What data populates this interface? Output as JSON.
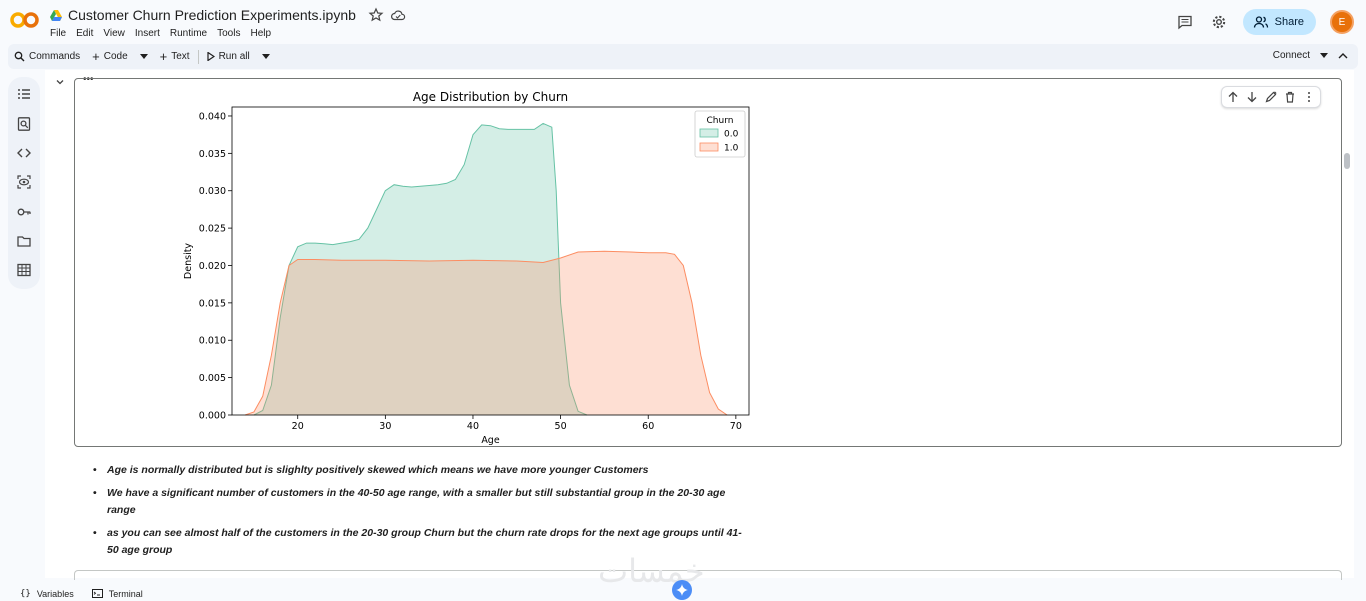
{
  "app": {
    "notebook_title": "Customer Churn Prediction Experiments.ipynb",
    "menu": [
      "File",
      "Edit",
      "View",
      "Insert",
      "Runtime",
      "Tools",
      "Help"
    ],
    "share_label": "Share",
    "avatar_letter": "E"
  },
  "toolbar": {
    "commands_label": "Commands",
    "code_label": "Code",
    "text_label": "Text",
    "run_all_label": "Run all",
    "connect_label": "Connect"
  },
  "statusbar": {
    "variables_label": "Variables",
    "terminal_label": "Terminal"
  },
  "output": {
    "markdown_items": [
      "Age is normally distributed but is slighlty positively skewed which means we have more younger Customers",
      "We have a significant number of customers in the 40-50 age range, with a smaller but still substantial group in the 20-30 age range",
      "as you can see almost half of the customers in the 20-30 group Churn but the churn rate drops for the next age groups until 41-50 age group"
    ]
  },
  "watermark": "خمسات",
  "colors": {
    "series_0": "#66c2a5",
    "series_1": "#fc8d62",
    "accent": "#c2e7ff"
  },
  "chart_data": {
    "type": "area",
    "title": "Age Distribution by Churn",
    "xlabel": "Age",
    "ylabel": "Density",
    "xlim": [
      12.5,
      71.5
    ],
    "ylim": [
      0,
      0.0412
    ],
    "xticks": [
      "20",
      "30",
      "40",
      "50",
      "60",
      "70"
    ],
    "yticks": [
      "0.000",
      "0.005",
      "0.010",
      "0.015",
      "0.020",
      "0.025",
      "0.030",
      "0.035",
      "0.040"
    ],
    "legend_title": "Churn",
    "legend_position": "top-right",
    "series": [
      {
        "name": "0.0",
        "x": [
          15,
          16,
          17,
          18,
          19,
          20,
          21,
          22,
          23,
          24,
          25,
          26,
          27,
          28,
          29,
          30,
          31,
          32,
          33,
          34,
          35,
          36,
          37,
          38,
          39,
          40,
          41,
          42,
          43,
          44,
          45,
          46,
          47,
          48,
          49,
          49.5,
          50,
          51,
          52,
          53
        ],
        "y": [
          0.0,
          0.0006,
          0.004,
          0.013,
          0.02,
          0.0225,
          0.023,
          0.023,
          0.0229,
          0.0228,
          0.023,
          0.0232,
          0.0235,
          0.025,
          0.0275,
          0.03,
          0.0308,
          0.0306,
          0.0305,
          0.0306,
          0.0307,
          0.0308,
          0.031,
          0.0315,
          0.0335,
          0.0375,
          0.0388,
          0.0387,
          0.0383,
          0.0382,
          0.0382,
          0.0382,
          0.0382,
          0.039,
          0.0385,
          0.03,
          0.015,
          0.004,
          0.0005,
          0.0
        ]
      },
      {
        "name": "1.0",
        "x": [
          14,
          15,
          16,
          17,
          18,
          19,
          20,
          22,
          25,
          30,
          35,
          40,
          45,
          48,
          50,
          52,
          55,
          58,
          60,
          62,
          63,
          64,
          65,
          66,
          67,
          68,
          69
        ],
        "y": [
          0.0,
          0.0004,
          0.0025,
          0.008,
          0.015,
          0.02,
          0.0208,
          0.0208,
          0.0207,
          0.0207,
          0.0206,
          0.0207,
          0.0206,
          0.0204,
          0.021,
          0.0218,
          0.0219,
          0.0218,
          0.0217,
          0.0217,
          0.0215,
          0.02,
          0.015,
          0.008,
          0.003,
          0.0008,
          0.0
        ]
      }
    ]
  }
}
